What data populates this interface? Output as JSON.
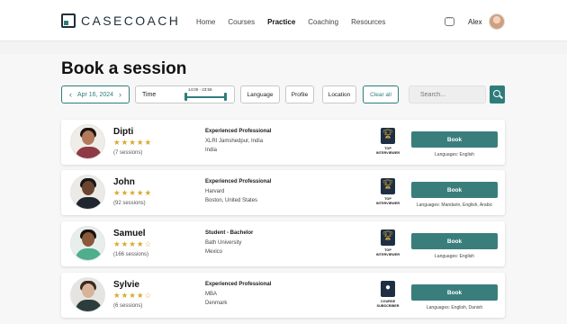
{
  "brand": {
    "name": "CASECOACH"
  },
  "nav": {
    "items": [
      {
        "label": "Home",
        "active": false
      },
      {
        "label": "Courses",
        "active": false
      },
      {
        "label": "Practice",
        "active": true
      },
      {
        "label": "Coaching",
        "active": false
      },
      {
        "label": "Resources",
        "active": false
      }
    ]
  },
  "user": {
    "name": "Alex",
    "chat_icon": "chat-bubble-icon"
  },
  "page": {
    "title": "Book a session"
  },
  "filters": {
    "date": "Apr 16, 2024",
    "prev_icon": "chevron-left-icon",
    "next_icon": "chevron-right-icon",
    "time_label": "Time",
    "time_range": "14:00 - 23:59",
    "language": "Language",
    "profile": "Profile",
    "location": "Location",
    "clear": "Clear all"
  },
  "search": {
    "placeholder": "Search...",
    "icon": "magnifier-icon"
  },
  "colors": {
    "accent": "#2e7d7b",
    "badge_bg": "#1e2f44",
    "star": "#d9a92b"
  },
  "book_label": "Book",
  "coaches": [
    {
      "name": "Dipti",
      "rating": 5,
      "stars": "★★★★★",
      "sessions": "(7 sessions)",
      "role": "Experienced Professional",
      "org": "XLRI Jamshedpur, India",
      "location": "India",
      "badge": {
        "icon": "trophy-icon",
        "line1": "TOP",
        "line2": "INTERVIEWER"
      },
      "languages": "Languages: English"
    },
    {
      "name": "John",
      "rating": 5,
      "stars": "★★★★★",
      "sessions": "(92 sessions)",
      "role": "Experienced Professional",
      "org": "Harvard",
      "location": "Boston, United States",
      "badge": {
        "icon": "trophy-icon",
        "line1": "TOP",
        "line2": "INTERVIEWER"
      },
      "languages": "Languages: Mandarin, English, Arabic"
    },
    {
      "name": "Samuel",
      "rating": 4.5,
      "stars": "★★★★☆",
      "sessions": "(166 sessions)",
      "role": "Student - Bachelor",
      "org": "Bath University",
      "location": "Mexico",
      "badge": {
        "icon": "trophy-icon",
        "line1": "TOP",
        "line2": "INTERVIEWER"
      },
      "languages": "Languages: English"
    },
    {
      "name": "Sylvie",
      "rating": 4.5,
      "stars": "★★★★☆",
      "sessions": "(6 sessions)",
      "role": "Experienced Professional",
      "org": "MBA",
      "location": "Denmark",
      "badge": {
        "icon": "person-icon",
        "line1": "COURSE",
        "line2": "SUBSCRIBER"
      },
      "languages": "Languages: English, Danish"
    }
  ]
}
